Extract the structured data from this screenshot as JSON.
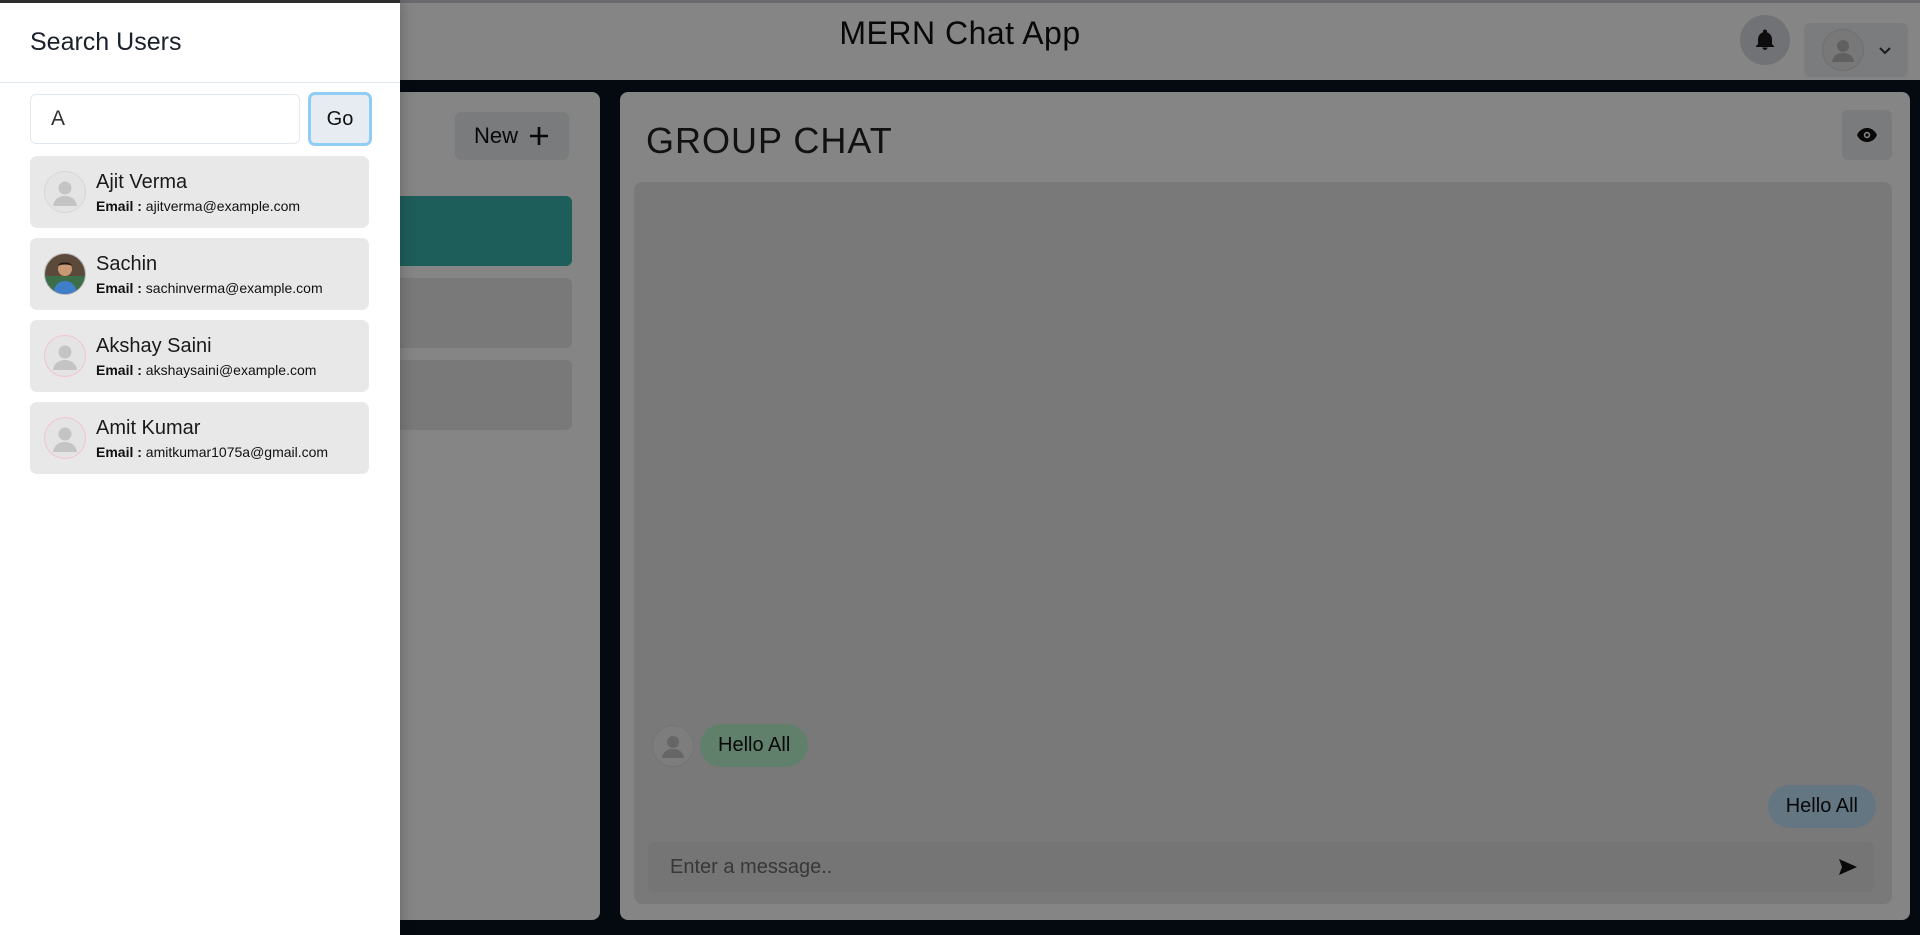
{
  "app": {
    "title": "MERN Chat App",
    "new_chat_label": "New",
    "chat_title": "GROUP CHAT",
    "message_placeholder": "Enter a message..",
    "messages": [
      {
        "side": "left",
        "text": "Hello All",
        "color": "#b9f5d0"
      },
      {
        "side": "right",
        "text": "Hello All",
        "color": "#bee3f8"
      }
    ]
  },
  "drawer": {
    "title": "Search Users",
    "search_value": "A",
    "go_label": "Go",
    "email_label": "Email :",
    "results": [
      {
        "name": "Ajit Verma",
        "email": "ajitverma@example.com",
        "avatar": "default-avatar-icon"
      },
      {
        "name": "Sachin",
        "email": "sachinverma@example.com",
        "avatar": "photo-avatar"
      },
      {
        "name": "Akshay Saini",
        "email": "akshaysaini@example.com",
        "avatar": "default-avatar-icon"
      },
      {
        "name": "Amit Kumar",
        "email": "amitkumar1075a@gmail.com",
        "avatar": "default-avatar-icon"
      }
    ]
  },
  "colors": {
    "accent_teal": "#38b2ac",
    "go_button_focus": "#90cdf4",
    "background": "#0b1522"
  }
}
